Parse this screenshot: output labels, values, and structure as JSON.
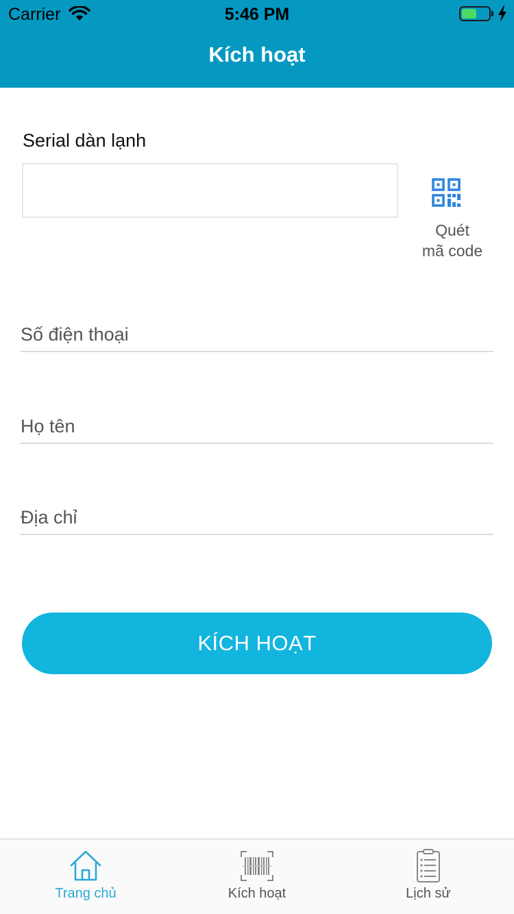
{
  "status_bar": {
    "carrier": "Carrier",
    "time": "5:46 PM",
    "battery_level": 0.55
  },
  "nav": {
    "title": "Kích hoạt"
  },
  "form": {
    "serial_label": "Serial dàn lạnh",
    "serial_value": "",
    "scan": {
      "line1": "Quét",
      "line2": "mã code",
      "icon": "qr-code-icon"
    },
    "phone_placeholder": "Số điện thoại",
    "name_placeholder": "Họ tên",
    "address_placeholder": "Địa chỉ",
    "submit_label": "KÍCH HOẠT"
  },
  "tabs": [
    {
      "label": "Trang chủ",
      "icon": "home-icon",
      "active": true
    },
    {
      "label": "Kích hoạt",
      "icon": "barcode-icon",
      "active": false
    },
    {
      "label": "Lịch sử",
      "icon": "history-list-icon",
      "active": false
    }
  ],
  "colors": {
    "header": "#0599c2",
    "button": "#12b5de",
    "active_tab": "#29a9d6",
    "qr_icon": "#2e86de"
  }
}
